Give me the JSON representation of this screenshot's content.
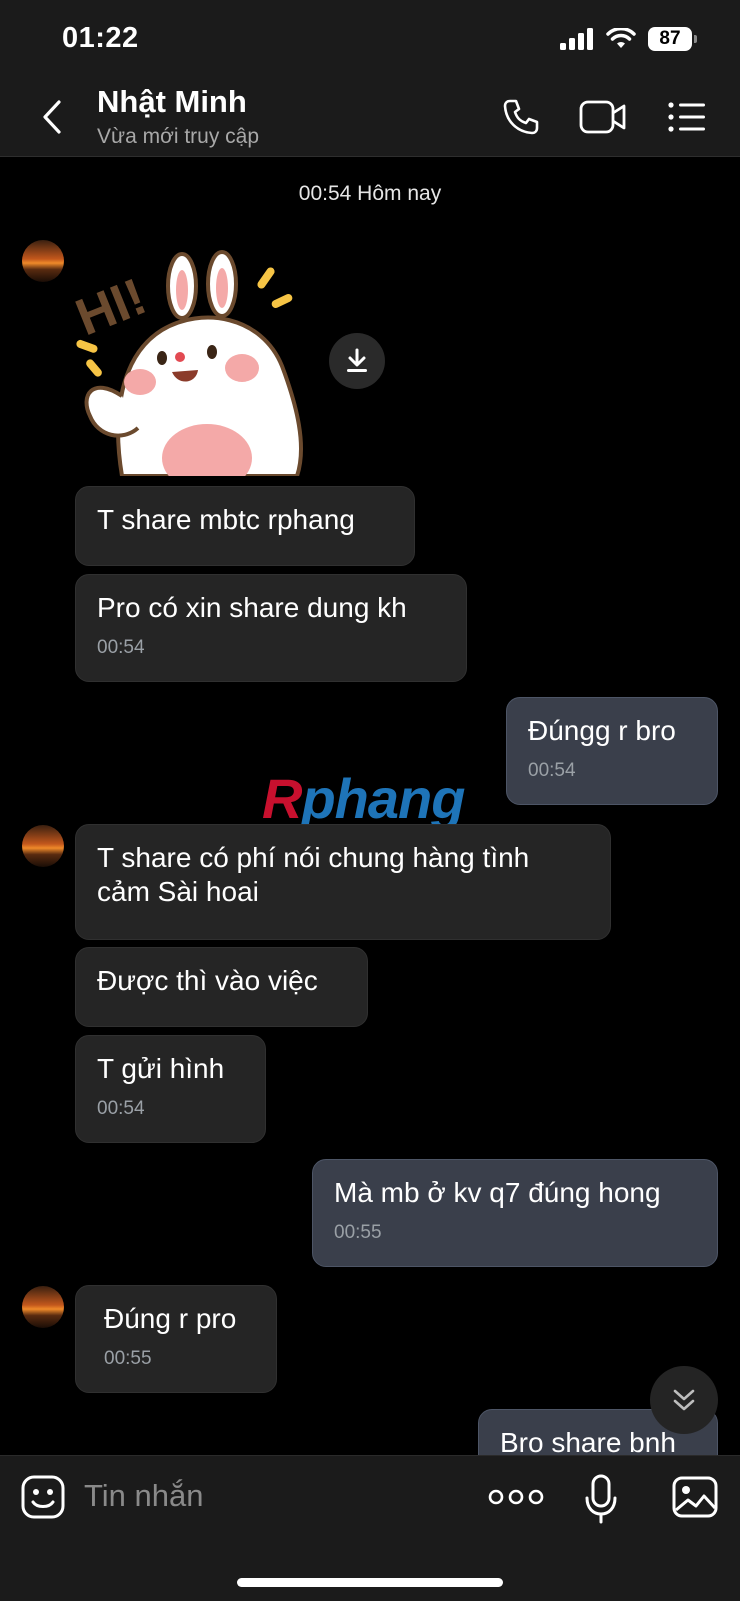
{
  "status_bar": {
    "time": "01:22",
    "battery": "87"
  },
  "header": {
    "contact_name": "Nhật Minh",
    "contact_status": "Vừa mới truy cập"
  },
  "chat": {
    "day_stamp": "00:54 Hôm nay",
    "sticker": {
      "text": "HI!"
    },
    "messages": [
      {
        "text": "T share mbtc rphang",
        "time": ""
      },
      {
        "text": "Pro có xin share dung kh",
        "time": "00:54"
      },
      {
        "text": "Đúngg r bro",
        "time": "00:54"
      },
      {
        "text": "T share có phí nói chung hàng tình cảm Sài hoai",
        "time": ""
      },
      {
        "text": "Được thì vào việc",
        "time": ""
      },
      {
        "text": "T gửi hình",
        "time": "00:54"
      },
      {
        "text": "Mà mb ở kv q7 đúng hong",
        "time": "00:55"
      },
      {
        "text": "Đúng r pro",
        "time": "00:55"
      },
      {
        "text": "Bro share bnh",
        "time": ""
      }
    ]
  },
  "watermark": {
    "r": "R",
    "rest": "phang"
  },
  "input": {
    "placeholder": "Tin nhắn"
  },
  "colors": {
    "background": "#000000",
    "incoming_bubble": "#252525",
    "outgoing_bubble": "#3a3f4b",
    "accent_red": "#c8102e",
    "accent_blue": "#1e74b8"
  }
}
